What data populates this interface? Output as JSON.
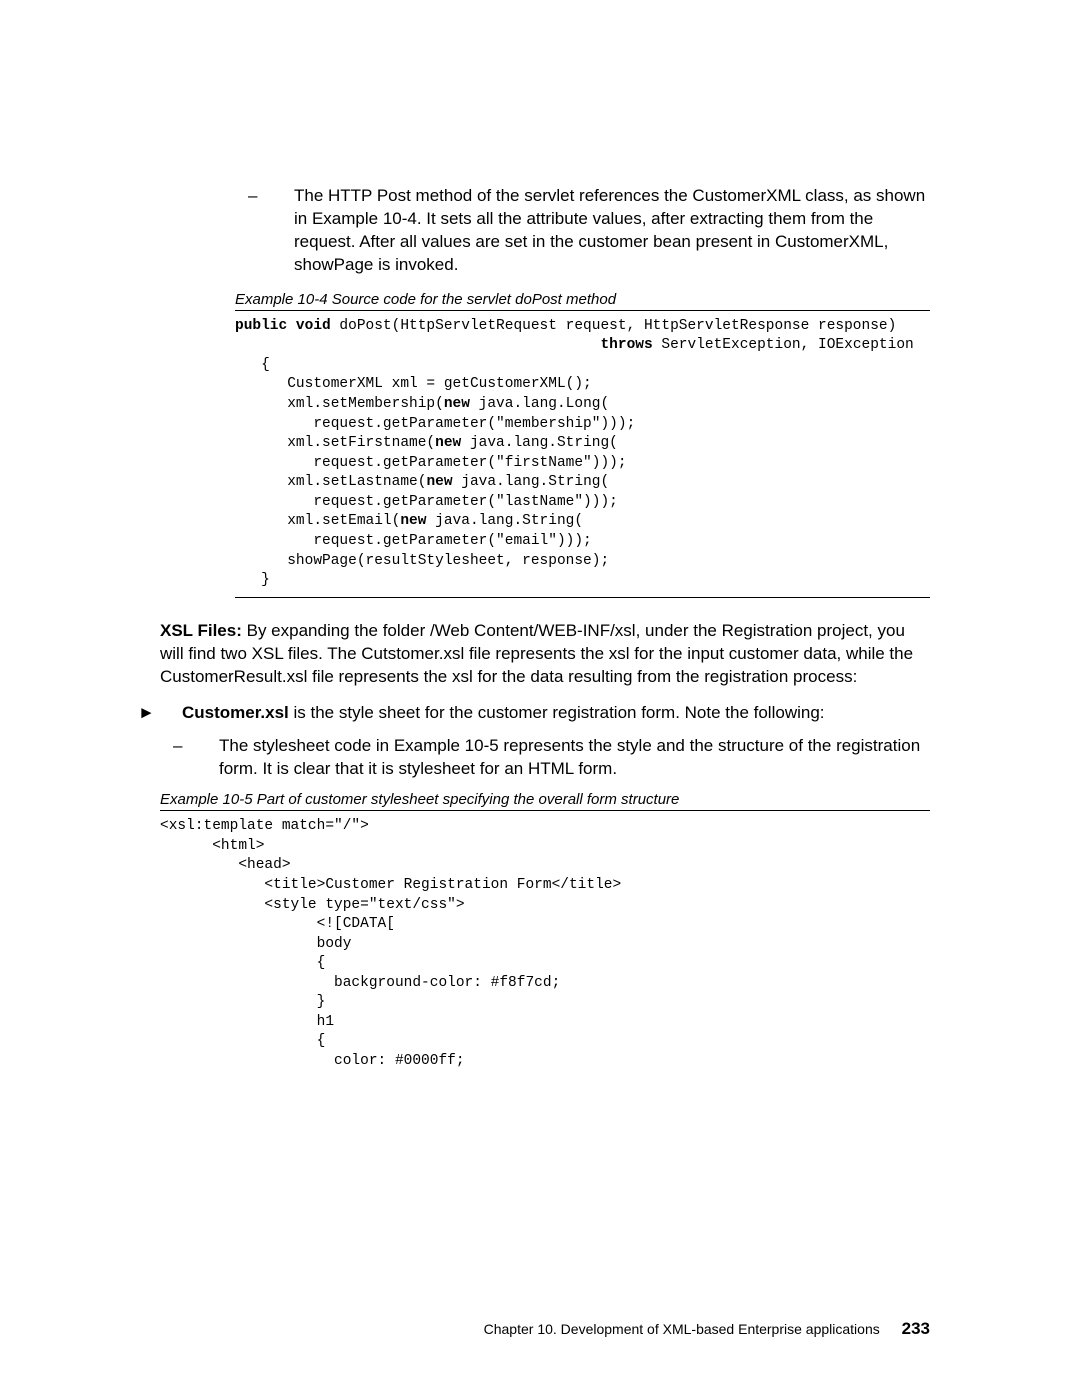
{
  "intro": {
    "text": "The HTTP Post method of the servlet references the CustomerXML class, as shown in Example 10-4. It sets all the attribute values, after extracting them from the request. After all values are set in the customer bean present in CustomerXML, showPage is invoked."
  },
  "example1": {
    "caption": "Example 10-4   Source code for the servlet doPost method",
    "line1a": "public void",
    "line1b": " doPost(HttpServletRequest request, HttpServletResponse response)",
    "line2a": "                                          ",
    "line2b": "throws",
    "line2c": " ServletException, IOException",
    "line3": "   {",
    "line4": "      CustomerXML xml = getCustomerXML();",
    "line5a": "      xml.setMembership(",
    "line5b": "new",
    "line5c": " java.lang.Long(",
    "line6": "         request.getParameter(\"membership\")));",
    "line7a": "      xml.setFirstname(",
    "line7b": "new",
    "line7c": " java.lang.String(",
    "line8": "         request.getParameter(\"firstName\")));",
    "line9a": "      xml.setLastname(",
    "line9b": "new",
    "line9c": " java.lang.String(",
    "line10": "         request.getParameter(\"lastName\")));",
    "line11a": "      xml.setEmail(",
    "line11b": "new",
    "line11c": " java.lang.String(",
    "line12": "         request.getParameter(\"email\")));",
    "line13": "      showPage(resultStylesheet, response);",
    "line14": "   }"
  },
  "xslpara": {
    "bold": "XSL Files:",
    "rest": " By expanding the folder /Web Content/WEB-INF/xsl, under the Registration project, you will find two XSL files. The Cutstomer.xsl file represents the xsl for the input customer data, while the CustomerResult.xsl file represents the xsl for the data resulting from the registration process:"
  },
  "bullet": {
    "bold": "Customer.xsl",
    "rest": " is the style sheet for the customer registration form. Note the following:"
  },
  "subbullet": {
    "text": "The stylesheet code in Example 10-5 represents the style and the structure of the registration form. It is clear that it is stylesheet for an HTML form."
  },
  "example2": {
    "caption": "Example 10-5   Part of customer stylesheet specifying the overall form structure",
    "code": "<xsl:template match=\"/\">\n      <html>\n         <head>\n            <title>Customer Registration Form</title>\n            <style type=\"text/css\">\n                  <![CDATA[\n                  body\n                  {\n                    background-color: #f8f7cd;\n                  }\n                  h1\n                  {\n                    color: #0000ff;"
  },
  "footer": {
    "chapter": "Chapter 10. Development of XML-based Enterprise applications",
    "page": "233"
  }
}
